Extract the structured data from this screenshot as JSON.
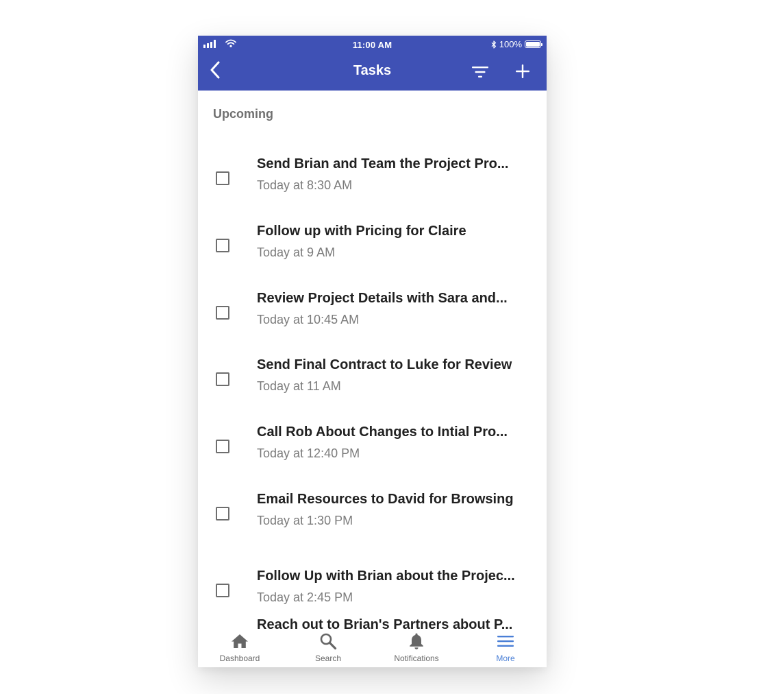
{
  "status_bar": {
    "time": "11:00 AM",
    "battery": "100%",
    "battery_level": 1.0
  },
  "header": {
    "title": "Tasks",
    "back_icon": "chevron-left-icon",
    "filter_icon": "filter-icon",
    "add_icon": "plus-icon"
  },
  "section": {
    "label": "Upcoming"
  },
  "tasks": [
    {
      "title": "Send Brian and Team the Project Pro...",
      "time": "Today at 8:30 AM",
      "checked": false
    },
    {
      "title": "Follow up with Pricing for Claire",
      "time": "Today at 9 AM",
      "checked": false
    },
    {
      "title": "Review Project Details with Sara and...",
      "time": "Today at 10:45 AM",
      "checked": false
    },
    {
      "title": "Send Final Contract to Luke for Review",
      "time": "Today at 11 AM",
      "checked": false
    },
    {
      "title": "Call Rob About Changes to Intial Pro...",
      "time": "Today at 12:40 PM",
      "checked": false
    },
    {
      "title": "Email Resources to David for Browsing",
      "time": "Today at 1:30 PM",
      "checked": false
    },
    {
      "title": "Follow Up with Brian about the Projec...",
      "time": "Today at 2:45 PM",
      "checked": false
    }
  ],
  "partial_task": {
    "title": "Reach out to Brian's Partners about P..."
  },
  "bottom_nav": [
    {
      "label": "Dashboard",
      "icon": "home-icon",
      "active": false
    },
    {
      "label": "Search",
      "icon": "search-icon",
      "active": false
    },
    {
      "label": "Notifications",
      "icon": "bell-icon",
      "active": false
    },
    {
      "label": "More",
      "icon": "menu-icon",
      "active": true
    }
  ],
  "colors": {
    "app_bar": "#3f51b5",
    "active_nav": "#4a7fd6",
    "inactive_nav": "#666666"
  }
}
